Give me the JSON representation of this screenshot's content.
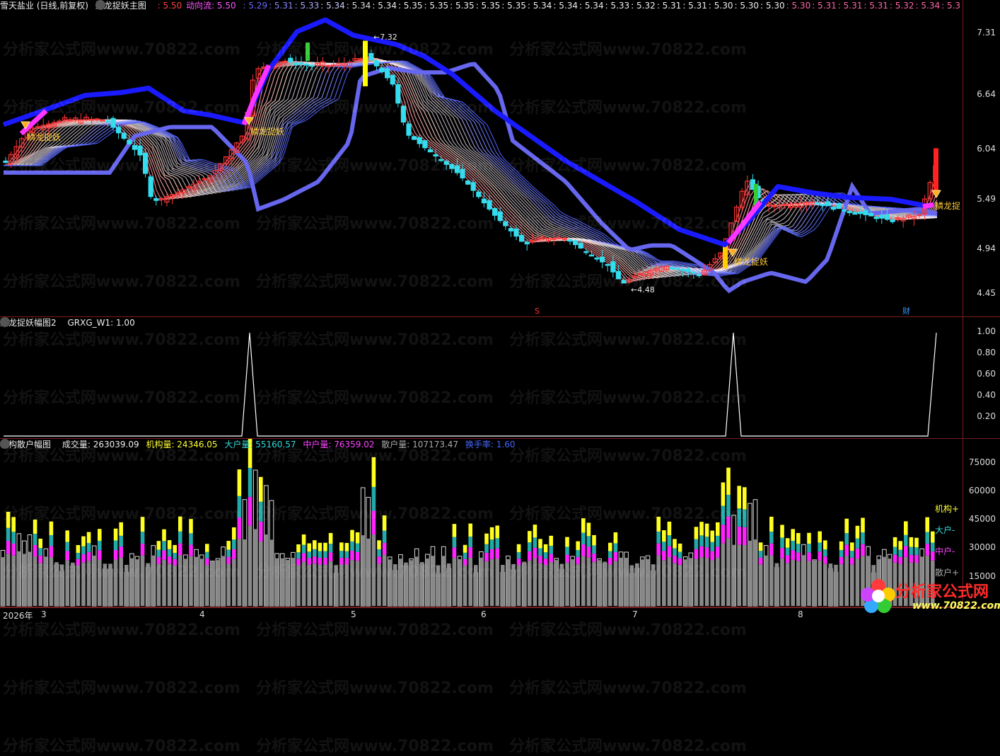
{
  "colors": {
    "up": "#ff3333",
    "down": "#33ddee",
    "blue": "#1a1aff",
    "magenta": "#ff33ff",
    "yellow": "#ffff00",
    "green": "#33cc33",
    "grid": "#7a1f1f"
  },
  "panel1": {
    "stock": "雪天盐业 (日线,前复权)",
    "indicator": "鳞龙捉妖主图",
    "first_value": ": 5.50",
    "flow_label": "动向流: 5.50",
    "series_values": [
      ": 5.29",
      ": 5.31",
      ": 5.33",
      ": 5.34",
      ": 5.34",
      ": 5.34",
      ": 5.35",
      ": 5.35",
      ": 5.35",
      ": 5.35",
      ": 5.35",
      ": 5.34",
      ": 5.34",
      ": 5.34",
      ": 5.33",
      ": 5.32",
      ": 5.31",
      ": 5.31",
      ": 5.30",
      ": 5.30",
      ": 5.30",
      ": 5.30",
      ": 5.31",
      ": 5.31",
      ": 5.31",
      ": 5.32",
      ": 5.34",
      ": 5.3"
    ],
    "ticks": [
      "7.31",
      "6.64",
      "6.04",
      "5.49",
      "4.94",
      "4.45"
    ],
    "high_label": "7.32",
    "low_label": "4.48",
    "signal_label": "鳞龙捉妖",
    "signal_label_cut": "鳞龙捉",
    "marker_s": "S",
    "marker_cai": "财"
  },
  "panel2": {
    "title": "鳞龙捉妖幅图2",
    "value_label": "GRXG_W1: 1.00",
    "ticks": [
      "1.00",
      "0.80",
      "0.60",
      "0.40",
      "0.20"
    ]
  },
  "panel3": {
    "title": "机构散户幅图",
    "vol": "成交量: 263039.09",
    "inst": "机构量: 24346.05",
    "big": "大户量: 55160.57",
    "mid": "中户量: 76359.02",
    "retail": "散户量: 107173.47",
    "turnover": "换手率: 1.60",
    "ticks": [
      "75000",
      "60000",
      "45000",
      "30000",
      "15000"
    ],
    "legend": [
      "机构+",
      "大户-",
      "中户-",
      "散户+"
    ]
  },
  "dates": [
    "2026年",
    "3",
    "4",
    "5",
    "6",
    "7",
    "8"
  ],
  "watermark": "分析家公式网www.70822.com",
  "logo": {
    "title": "分析家公式网",
    "url": "www.70822.com"
  }
}
